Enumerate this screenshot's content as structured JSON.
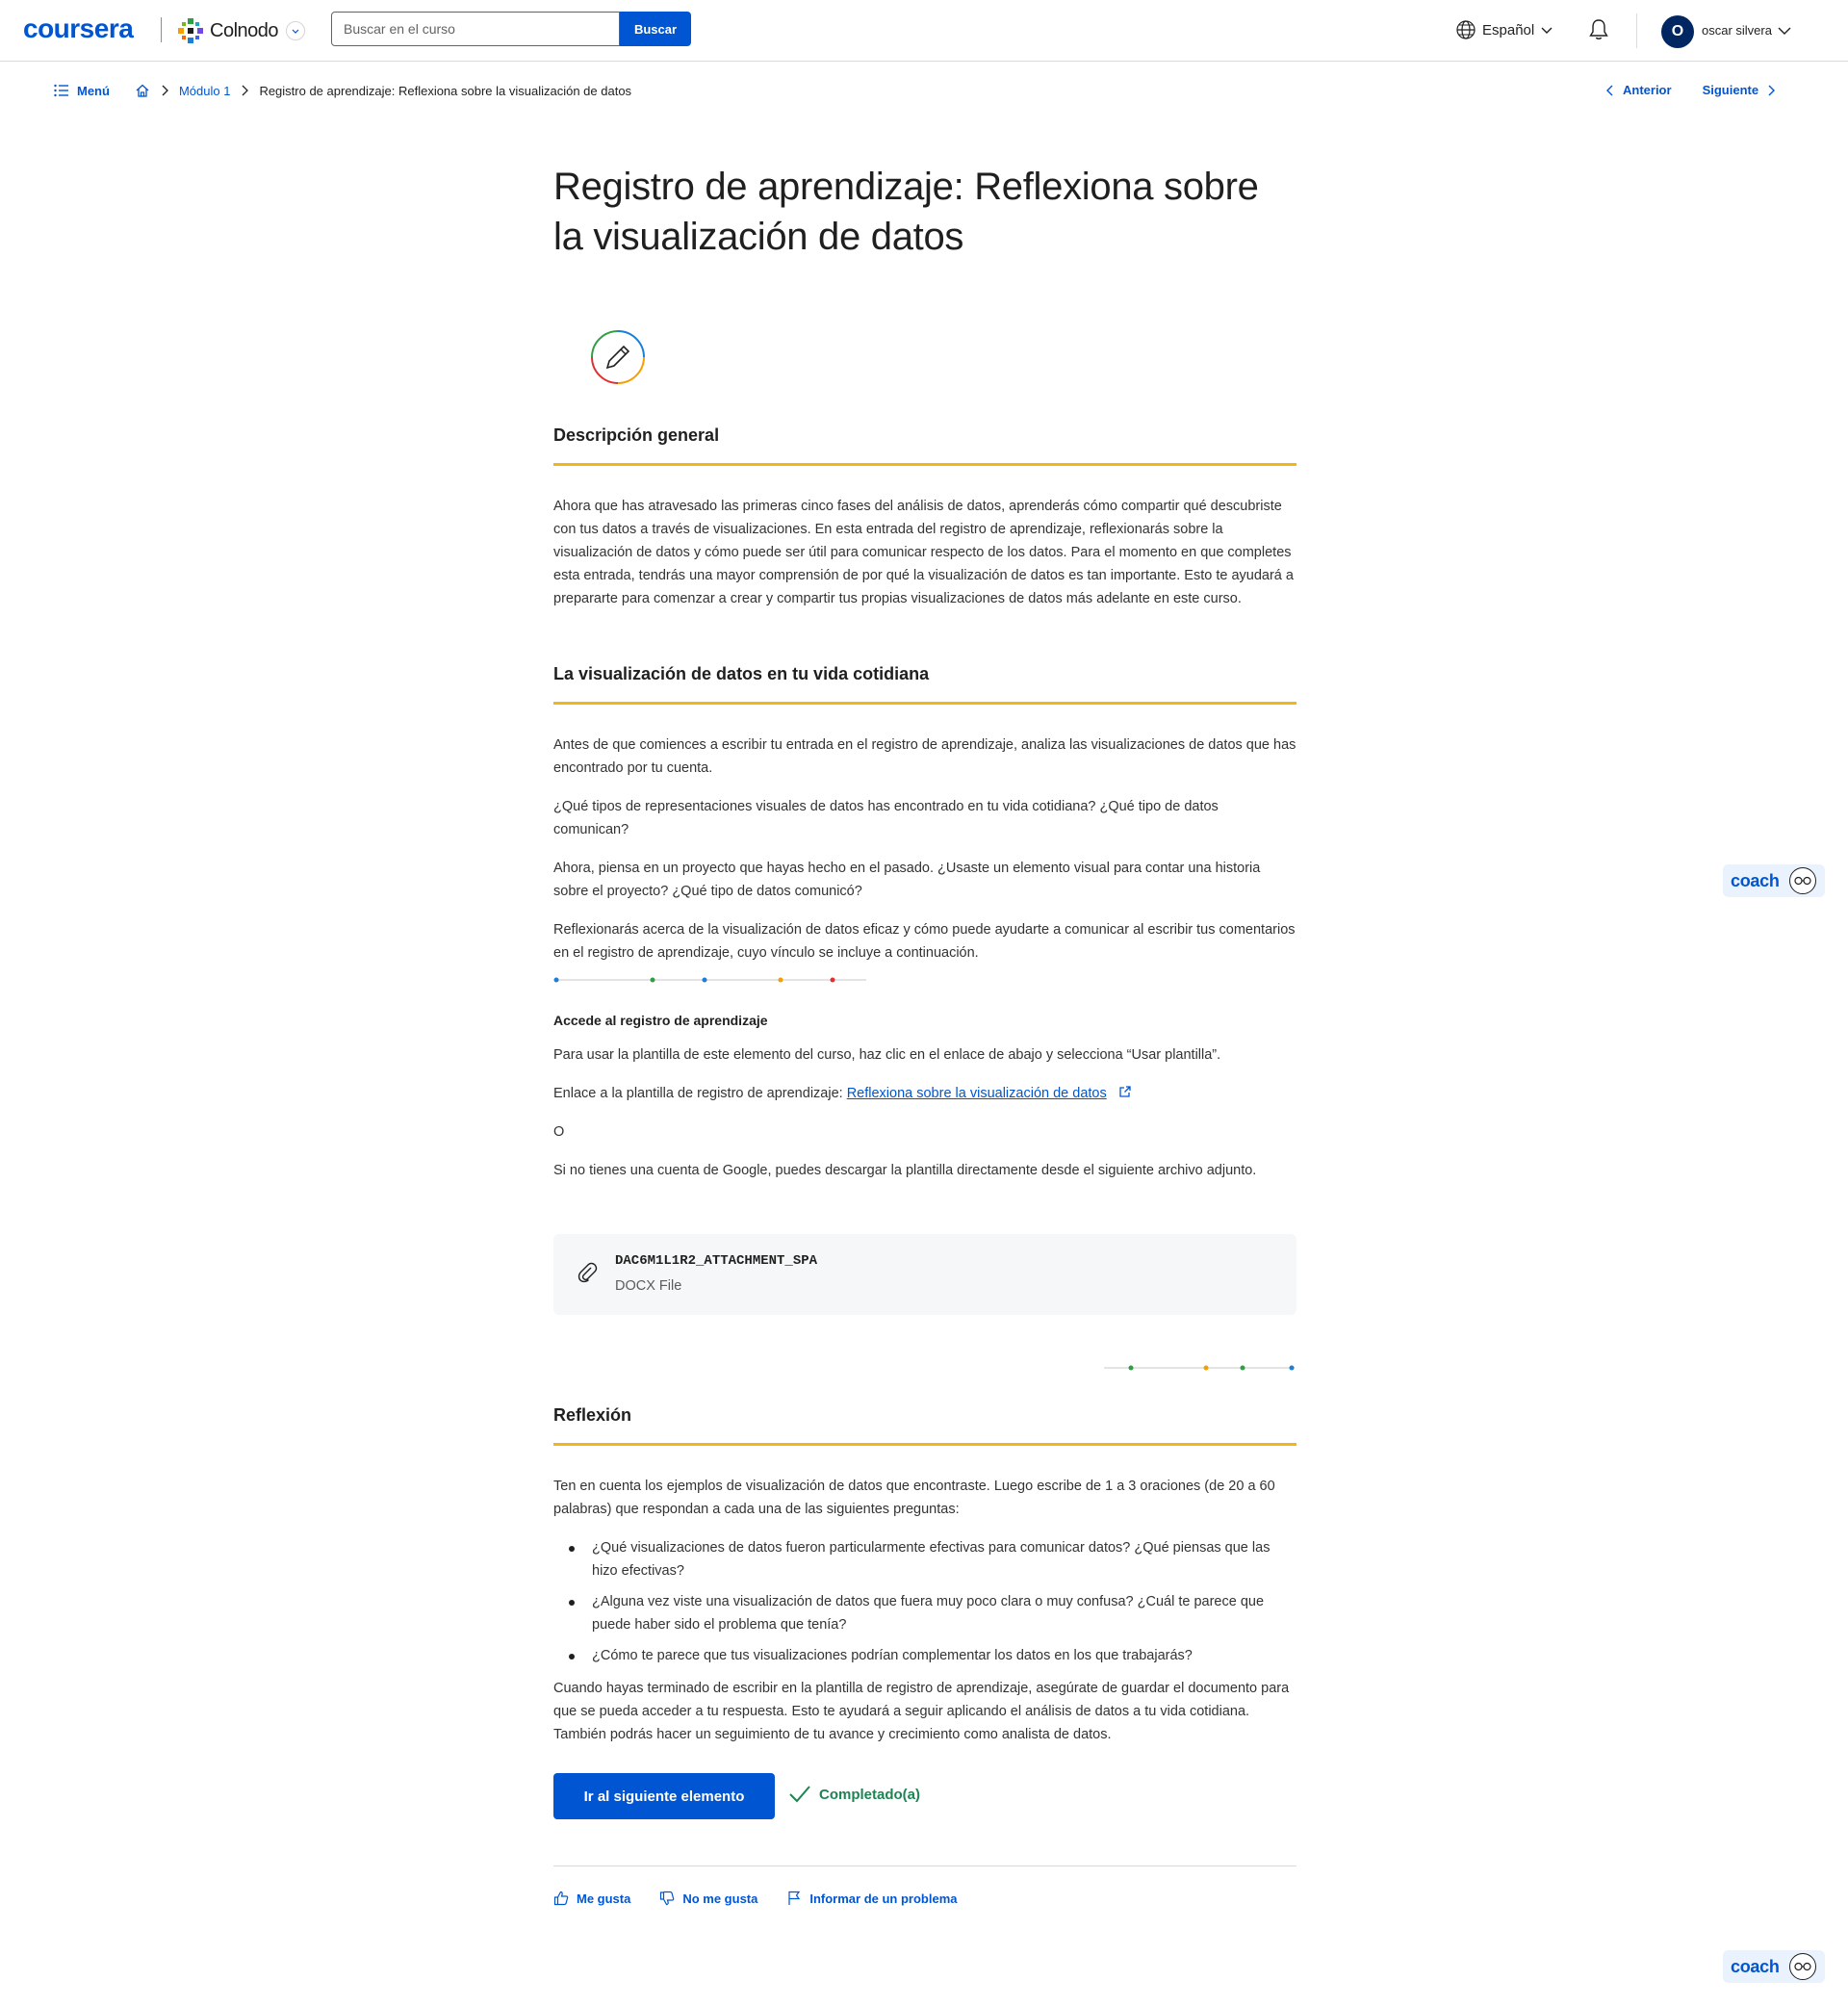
{
  "header": {
    "logo": "coursera",
    "partner": "Colnodo",
    "search_placeholder": "Buscar en el curso",
    "search_button": "Buscar",
    "language": "Español",
    "avatar_initial": "O",
    "username": "oscar silvera"
  },
  "breadcrumb": {
    "menu": "Menú",
    "module": "Módulo 1",
    "current": "Registro de aprendizaje: Reflexiona sobre la visualización de datos"
  },
  "nav": {
    "prev": "Anterior",
    "next": "Siguiente"
  },
  "content": {
    "title": "Registro de aprendizaje: Reflexiona sobre la visualización de datos",
    "overview_heading": "Descripción general",
    "overview_text": "Ahora que has atravesado las primeras cinco fases del análisis de datos, aprenderás cómo compartir qué descubriste con tus datos a través de visualizaciones. En esta entrada del registro de aprendizaje, reflexionarás sobre la visualización de datos y cómo puede ser útil para comunicar respecto de los datos. Para el momento en que completes esta entrada, tendrás una mayor comprensión de por qué la visualización de datos es tan importante. Esto te ayudará a prepararte para comenzar a crear y compartir tus propias visualizaciones de datos más adelante en este curso.",
    "daily_heading": "La visualización de datos en tu vida cotidiana",
    "daily_p1": "Antes de que comiences a escribir tu entrada en el registro de aprendizaje, analiza las visualizaciones de datos que has encontrado por tu cuenta.",
    "daily_p2": "¿Qué tipos de representaciones visuales de datos has encontrado en tu vida cotidiana? ¿Qué tipo de datos comunican?",
    "daily_p3": "Ahora, piensa en un proyecto que hayas hecho en el pasado. ¿Usaste un elemento visual para contar una historia sobre el proyecto? ¿Qué tipo de datos comunicó?",
    "daily_p4": "Reflexionarás acerca de la visualización de datos eficaz y cómo puede ayudarte a comunicar al escribir tus comentarios en el registro de aprendizaje, cuyo vínculo se incluye a continuación.",
    "access_heading": "Accede al registro de aprendizaje",
    "access_p1": "Para usar la plantilla de este elemento del curso, haz clic en el enlace de abajo y selecciona “Usar plantilla”.",
    "link_prefix": "Enlace a la plantilla de registro de aprendizaje: ",
    "link_text": "Reflexiona sobre la visualización de datos",
    "or_text": "O",
    "access_p2": "Si no tienes una cuenta de Google, puedes descargar la plantilla directamente desde el siguiente archivo adjunto.",
    "attachment_name": "DAC6M1L1R2_ATTACHMENT_SPA",
    "attachment_type": "DOCX File",
    "reflection_heading": "Reflexión",
    "reflection_p1": "Ten en cuenta los ejemplos de visualización de datos que encontraste. Luego escribe de 1 a 3 oraciones (de 20 a 60 palabras) que respondan a cada una de las siguientes preguntas:",
    "questions": [
      "¿Qué visualizaciones de datos fueron particularmente efectivas para comunicar datos? ¿Qué piensas que las hizo efectivas?",
      "¿Alguna vez viste una visualización de datos que fuera muy poco clara o muy confusa? ¿Cuál te parece que puede haber sido el problema que tenía?",
      "¿Cómo te parece que tus visualizaciones podrían complementar los datos en los que trabajarás?"
    ],
    "reflection_p2": "Cuando hayas terminado de escribir en la plantilla de registro de aprendizaje, asegúrate de guardar el documento para que se pueda acceder a tu respuesta. Esto te ayudará a seguir aplicando el análisis de datos a tu vida cotidiana. También podrás hacer un seguimiento de tu avance y crecimiento como analista de datos.",
    "next_button": "Ir al siguiente elemento",
    "completed": "Completado(a)"
  },
  "feedback": {
    "like": "Me gusta",
    "dislike": "No me gusta",
    "report": "Informar de un problema"
  },
  "coach": {
    "label": "coach"
  },
  "colors": {
    "brand": "#0056d2",
    "heading_rule": "#f2b61c",
    "success": "#1f8354"
  }
}
